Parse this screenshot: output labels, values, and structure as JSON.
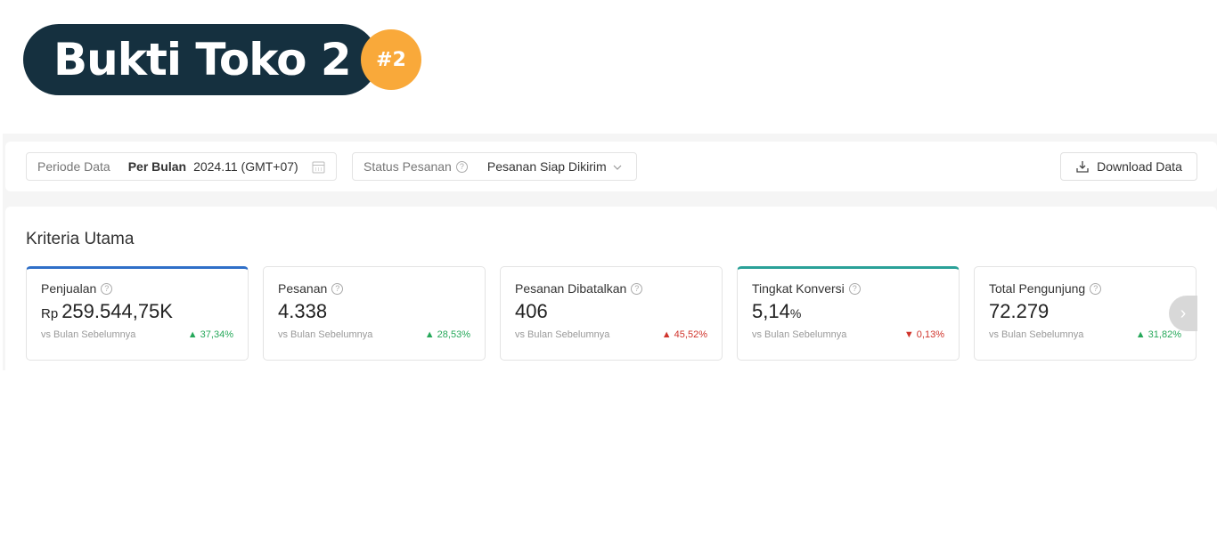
{
  "banner": {
    "title": "Bukti Toko 2",
    "number": "#2"
  },
  "filters": {
    "period_label": "Periode Data",
    "period_type": "Per Bulan",
    "period_value": "2024.11 (GMT+07)",
    "status_label": "Status Pesanan",
    "status_value": "Pesanan Siap Dikirim"
  },
  "toolbar": {
    "download_label": "Download Data"
  },
  "section": {
    "title": "Kriteria Utama"
  },
  "cards": [
    {
      "title": "Penjualan",
      "prefix": "Rp",
      "value": "259.544,75K",
      "suffix": "",
      "compare": "vs Bulan Sebelumnya",
      "change": "▲ 37,34%",
      "trend": "up"
    },
    {
      "title": "Pesanan",
      "prefix": "",
      "value": "4.338",
      "suffix": "",
      "compare": "vs Bulan Sebelumnya",
      "change": "▲ 28,53%",
      "trend": "up"
    },
    {
      "title": "Pesanan Dibatalkan",
      "prefix": "",
      "value": "406",
      "suffix": "",
      "compare": "vs Bulan Sebelumnya",
      "change": "▲ 45,52%",
      "trend": "up"
    },
    {
      "title": "Tingkat Konversi",
      "prefix": "",
      "value": "5,14",
      "suffix": "%",
      "compare": "vs Bulan Sebelumnya",
      "change": "▼ 0,13%",
      "trend": "down"
    },
    {
      "title": "Total Pengunjung",
      "prefix": "",
      "value": "72.279",
      "suffix": "",
      "compare": "vs Bulan Sebelumnya",
      "change": "▲ 31,82%",
      "trend": "up"
    }
  ],
  "colors": {
    "up_good": "#26a85a",
    "bad": "#d0342c",
    "selected_blue": "#2f6fc8",
    "selected_teal": "#2aa198",
    "banner_dark": "#15303f",
    "banner_accent": "#f9a93a"
  }
}
